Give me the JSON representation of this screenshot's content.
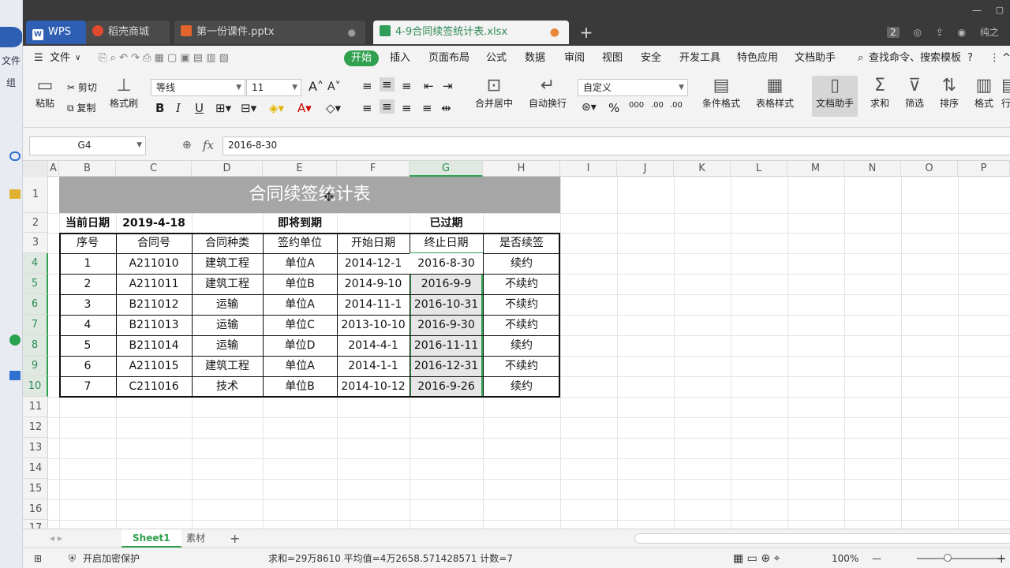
{
  "desktop_strip": {
    "items": [
      "文件",
      "组"
    ]
  },
  "tabs": [
    {
      "label": "WPS"
    },
    {
      "label": "稻壳商城"
    },
    {
      "label": "第一份课件.pptx"
    },
    {
      "label": "4-9合同续签统计表.xlsx"
    }
  ],
  "tabbar_right": {
    "badge": "2",
    "user": "纯之"
  },
  "menu": {
    "file": "文件",
    "items": [
      "开始",
      "插入",
      "页面布局",
      "公式",
      "数据",
      "审阅",
      "视图",
      "安全",
      "开发工具",
      "特色应用",
      "文档助手"
    ],
    "search": "查找命令、搜索模板",
    "help": "?"
  },
  "ribbon": {
    "paste": "粘贴",
    "cut": "剪切",
    "copy": "复制",
    "format_painter": "格式刷",
    "font_name": "等线",
    "font_size": "11",
    "grow_font": "A",
    "shrink_font": "A",
    "bold": "B",
    "italic": "I",
    "underline": "U",
    "merge_center": "合并居中",
    "wrap_text": "自动换行",
    "number_format": "自定义",
    "percent": "%",
    "thousands": "000",
    "inc_decimal": ".00",
    "dec_decimal": ".00",
    "cond_format": "条件格式",
    "table_style": "表格样式",
    "doc_assistant": "文档助手",
    "sum": "求和",
    "filter": "筛选",
    "sort": "排序",
    "format": "格式",
    "row_col": "行"
  },
  "formula_bar": {
    "cell_ref": "G4",
    "fx": "fx",
    "value": "2016-8-30"
  },
  "grid": {
    "columns": [
      "A",
      "B",
      "C",
      "D",
      "E",
      "F",
      "G",
      "H",
      "I",
      "J",
      "K",
      "L",
      "M",
      "N",
      "O",
      "P"
    ],
    "rows": [
      "1",
      "2",
      "3",
      "4",
      "5",
      "6",
      "7",
      "8",
      "9",
      "10",
      "11",
      "12",
      "13",
      "14",
      "15",
      "16",
      "17"
    ],
    "selected_column": "G",
    "title": "合同续签统计表",
    "row2": {
      "current_date_label": "当前日期",
      "current_date": "2019-4-18",
      "expiring": "即将到期",
      "expired": "已过期"
    },
    "headers": [
      "序号",
      "合同号",
      "合同种类",
      "签约单位",
      "开始日期",
      "终止日期",
      "是否续签"
    ],
    "records": [
      [
        "1",
        "A211010",
        "建筑工程",
        "单位A",
        "2014-12-1",
        "2016-8-30",
        "续约"
      ],
      [
        "2",
        "A211011",
        "建筑工程",
        "单位B",
        "2014-9-10",
        "2016-9-9",
        "不续约"
      ],
      [
        "3",
        "B211012",
        "运输",
        "单位A",
        "2014-11-1",
        "2016-10-31",
        "不续约"
      ],
      [
        "4",
        "B211013",
        "运输",
        "单位C",
        "2013-10-10",
        "2016-9-30",
        "不续约"
      ],
      [
        "5",
        "B211014",
        "运输",
        "单位D",
        "2014-4-1",
        "2016-11-11",
        "续约"
      ],
      [
        "6",
        "A211015",
        "建筑工程",
        "单位A",
        "2014-1-1",
        "2016-12-31",
        "不续约"
      ],
      [
        "7",
        "C211016",
        "技术",
        "单位B",
        "2014-10-12",
        "2016-9-26",
        "续约"
      ]
    ]
  },
  "sheets": {
    "tabs": [
      "Sheet1",
      "素材"
    ],
    "add": "+"
  },
  "status": {
    "protect": "开启加密保护",
    "summary": "求和=29万8610  平均值=4万2658.571428571  计数=7",
    "zoom": "100%",
    "minus": "—",
    "plus": "+"
  }
}
